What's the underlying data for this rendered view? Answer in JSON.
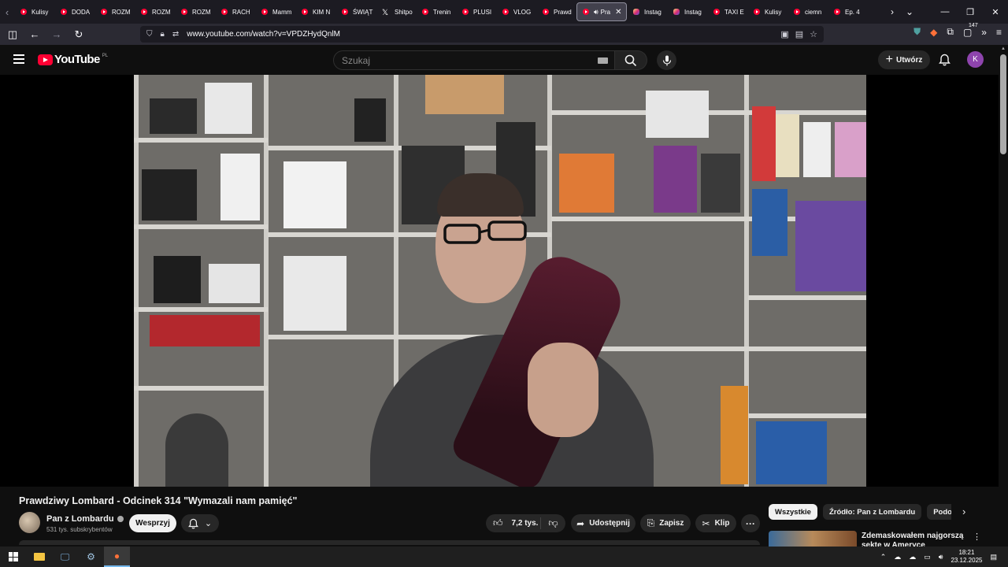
{
  "browser": {
    "tabs": [
      {
        "label": "Kulisy",
        "icon": "youtube-icon"
      },
      {
        "label": "DODA",
        "icon": "youtube-icon"
      },
      {
        "label": "ROZM",
        "icon": "youtube-icon"
      },
      {
        "label": "ROZM",
        "icon": "youtube-icon"
      },
      {
        "label": "ROZM",
        "icon": "youtube-icon"
      },
      {
        "label": "RACH",
        "icon": "youtube-icon"
      },
      {
        "label": "Mamm",
        "icon": "youtube-icon"
      },
      {
        "label": "KIM N",
        "icon": "youtube-icon"
      },
      {
        "label": "ŚWIĄT",
        "icon": "youtube-icon"
      },
      {
        "label": "Shitpo",
        "icon": "x-icon"
      },
      {
        "label": "Trenin",
        "icon": "youtube-icon"
      },
      {
        "label": "PLUSI",
        "icon": "youtube-icon"
      },
      {
        "label": "VLOG",
        "icon": "youtube-icon"
      },
      {
        "label": "Prawd",
        "icon": "youtube-icon"
      },
      {
        "label": "Pra",
        "icon": "youtube-icon",
        "active": true
      },
      {
        "label": "Instag",
        "icon": "instagram-icon"
      },
      {
        "label": "Instag",
        "icon": "instagram-icon"
      },
      {
        "label": "TAXI E",
        "icon": "youtube-icon"
      },
      {
        "label": "Kulisy",
        "icon": "youtube-icon"
      },
      {
        "label": "ciemn",
        "icon": "youtube-icon"
      },
      {
        "label": "Ep. 4",
        "icon": "youtube-icon"
      }
    ],
    "url": "www.youtube.com/watch?v=VPDZHydQnlM",
    "extension_badge": "147"
  },
  "youtube": {
    "logo_text": "YouTube",
    "country_code": "PL",
    "search_placeholder": "Szukaj",
    "create_label": "Utwórz",
    "avatar_letter": "K"
  },
  "video": {
    "title": "Prawdziwy Lombard - Odcinek 314 \"Wymazali nam pamięć\"",
    "channel_name": "Pan z Lombardu",
    "subscribers": "531 tys. subskrybentów",
    "support_label": "Wesprzyj",
    "likes": "7,2 tys.",
    "share_label": "Udostępnij",
    "save_label": "Zapisz",
    "clip_label": "Klip"
  },
  "recommendations": {
    "chips": [
      "Wszystkie",
      "Źródło: Pan z Lombardu",
      "Podobne"
    ],
    "first_title": "Zdemaskowałem najgorszą sektę w Ameryce"
  },
  "taskbar": {
    "time": "18:21",
    "date": "23.12.2025"
  },
  "colors": {
    "youtube_red": "#ff0033",
    "page_bg": "#0f0f0f",
    "pill_bg": "#272727"
  }
}
